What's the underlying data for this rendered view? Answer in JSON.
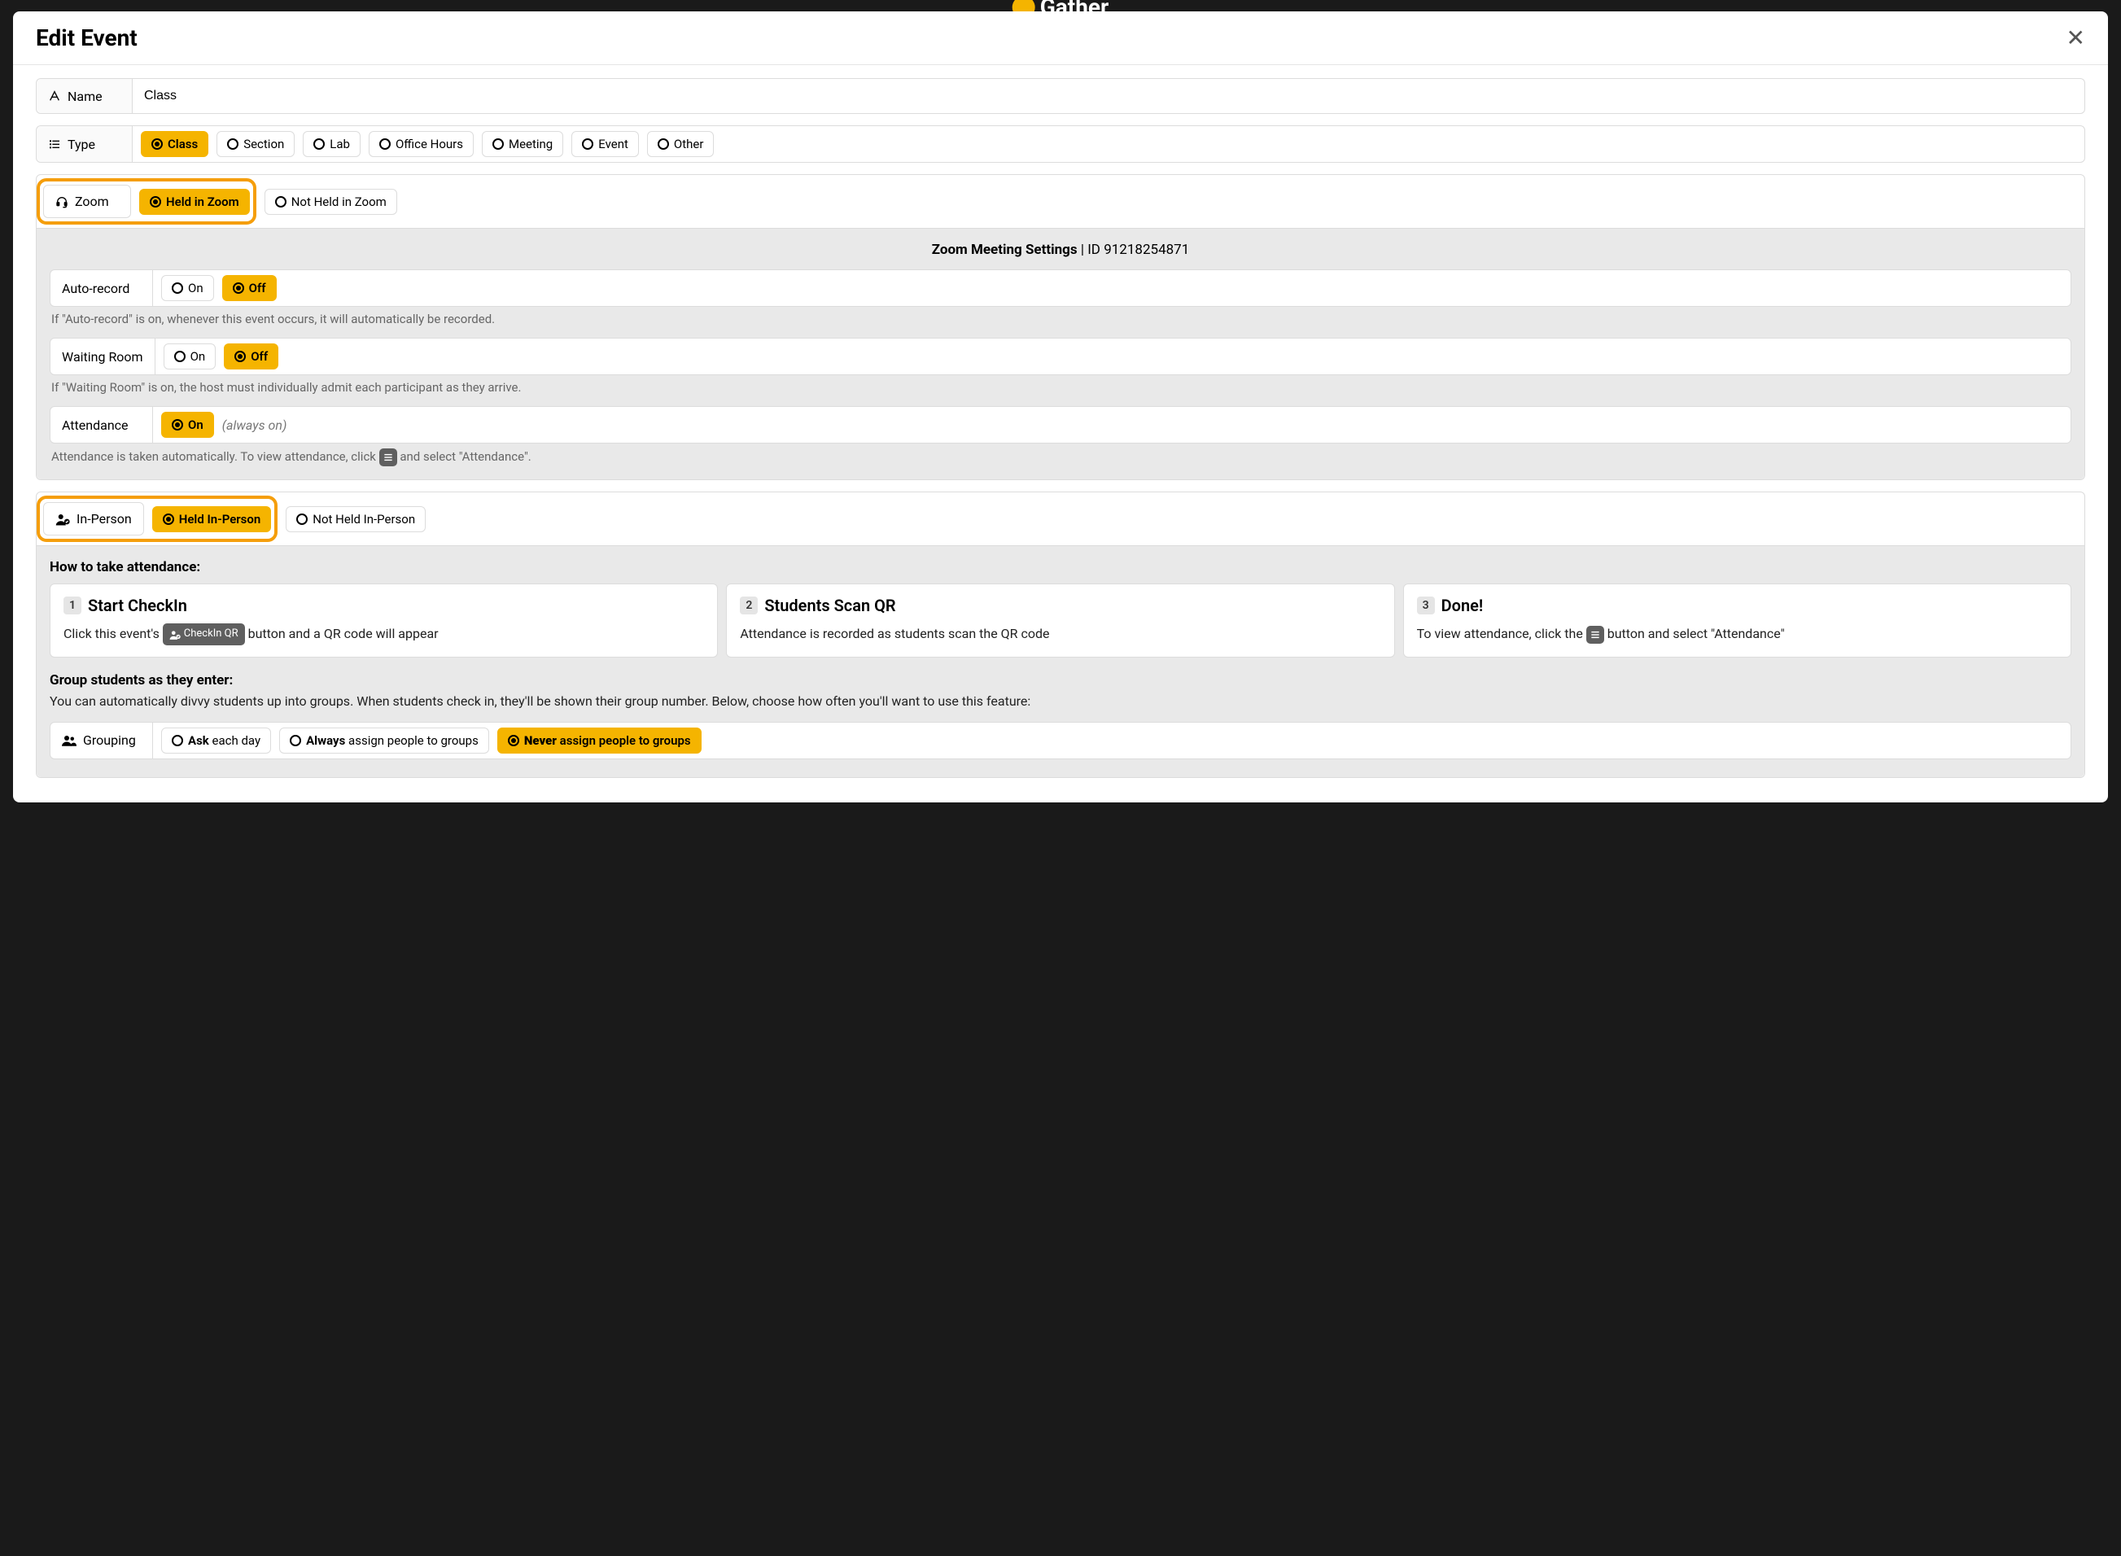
{
  "app": {
    "name": "Gather"
  },
  "modal": {
    "title": "Edit Event",
    "fields": {
      "name": {
        "label": "Name",
        "value": "Class"
      },
      "type": {
        "label": "Type",
        "options": [
          "Class",
          "Section",
          "Lab",
          "Office Hours",
          "Meeting",
          "Event",
          "Other"
        ],
        "selected": "Class"
      },
      "zoom": {
        "label": "Zoom",
        "options": [
          "Held in Zoom",
          "Not Held in Zoom"
        ],
        "selected": "Held in Zoom",
        "panel": {
          "title_prefix": "Zoom Meeting Settings",
          "id_label": "ID",
          "id": "91218254871",
          "auto_record": {
            "label": "Auto-record",
            "options": [
              "On",
              "Off"
            ],
            "selected": "Off",
            "hint": "If \"Auto-record\" is on, whenever this event occurs, it will automatically be recorded."
          },
          "waiting_room": {
            "label": "Waiting Room",
            "options": [
              "On",
              "Off"
            ],
            "selected": "Off",
            "hint": "If \"Waiting Room\" is on, the host must individually admit each participant as they arrive."
          },
          "attendance": {
            "label": "Attendance",
            "options": [
              "On"
            ],
            "selected": "On",
            "note": "(always on)",
            "hint_pre": "Attendance is taken automatically. To view attendance, click ",
            "hint_post": " and select \"Attendance\"."
          }
        }
      },
      "in_person": {
        "label": "In-Person",
        "options": [
          "Held In-Person",
          "Not Held In-Person"
        ],
        "selected": "Held In-Person",
        "panel": {
          "howto_title": "How to take attendance:",
          "steps": [
            {
              "n": "1",
              "title": "Start CheckIn",
              "body_pre": "Click this event's ",
              "chip": "CheckIn QR",
              "body_post": " button and a QR code will appear"
            },
            {
              "n": "2",
              "title": "Students Scan QR",
              "body": "Attendance is recorded as students scan the QR code"
            },
            {
              "n": "3",
              "title": "Done!",
              "body_pre": "To view attendance, click the ",
              "body_post": " button and select \"Attendance\""
            }
          ],
          "group_title": "Group students as they enter:",
          "group_desc": "You can automatically divvy students up into groups. When students check in, they'll be shown their group number. Below, choose how often you'll want to use this feature:",
          "grouping": {
            "label": "Grouping",
            "options": [
              {
                "bold": "Ask",
                "rest": " each day"
              },
              {
                "bold": "Always",
                "rest": " assign people to groups"
              },
              {
                "bold": "Never",
                "rest": " assign people to groups"
              }
            ],
            "selected_index": 2
          }
        }
      }
    }
  }
}
